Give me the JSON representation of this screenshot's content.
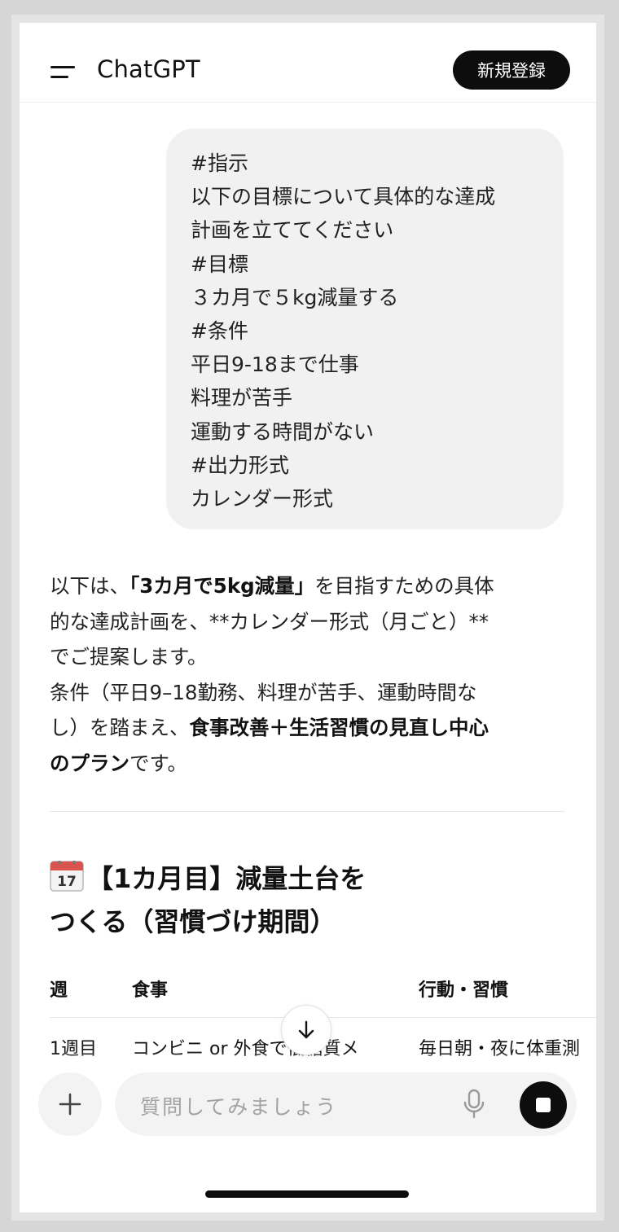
{
  "header": {
    "app_title": "ChatGPT",
    "signup_label": "新規登録"
  },
  "user_message": {
    "lines": [
      "#指示",
      "以下の目標について具体的な達成",
      "計画を立ててください",
      "#目標",
      "３カ月で５kg減量する",
      "#条件",
      "平日9-18まで仕事",
      "料理が苦手",
      "運動する時間がない",
      "#出力形式",
      "カレンダー形式"
    ]
  },
  "response": {
    "l1_a": "以下は、",
    "l1_b": "「3カ月で5kg減量」",
    "l1_c": "を目指すための具体",
    "l2": "的な達成計画を、**カレンダー形式（月ごと）**",
    "l3": "でご提案します。",
    "l4": "条件（平日9–18勤務、料理が苦手、運動時間な",
    "l5_a": "し）を踏まえ、",
    "l5_b": "食事改善＋生活習慣の見直し中心",
    "l6_a": "のプラン",
    "l6_b": "です。"
  },
  "section": {
    "calendar_icon_day": "17",
    "heading_line1": "【1カ月目】減量土台を",
    "heading_line2": "つくる（習慣づけ期間）"
  },
  "table": {
    "headers": [
      "週",
      "食事",
      "行動・習慣"
    ],
    "rows": [
      [
        "1週目",
        "コンビニ or 外食で低糖質メ",
        "毎日朝・夜に体重測"
      ]
    ]
  },
  "composer": {
    "placeholder": "質問してみましょう"
  },
  "colors": {
    "accent_dark": "#0d0d0d",
    "bubble_bg": "#f1f1f1",
    "placeholder": "#a3a3a3"
  }
}
